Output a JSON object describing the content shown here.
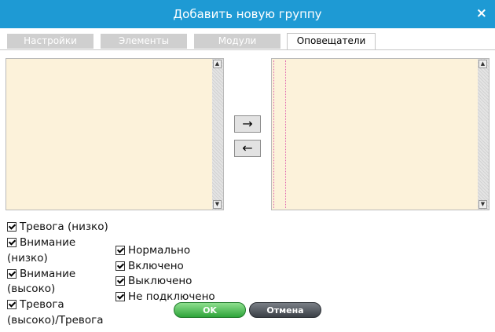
{
  "dialog": {
    "title": "Добавить новую группу",
    "close_glyph": "×"
  },
  "tabs": [
    {
      "label": "Настройки",
      "active": false
    },
    {
      "label": "Элементы",
      "active": false
    },
    {
      "label": "Модули",
      "active": false
    },
    {
      "label": "Оповещатели",
      "active": true
    }
  ],
  "transfer": {
    "add_glyph": "→",
    "remove_glyph": "←"
  },
  "scroll": {
    "up_glyph": "▲",
    "down_glyph": "▼"
  },
  "checkboxes_left": [
    {
      "label": "Тревога (низко)",
      "checked": true
    },
    {
      "label": "Внимание",
      "continuation": "(низко)",
      "checked": true
    },
    {
      "label": "Внимание",
      "continuation": "(высоко)",
      "checked": true
    },
    {
      "label": "Тревога",
      "continuation": "(высоко)/Тревога",
      "checked": true
    }
  ],
  "checkboxes_right": [
    {
      "label": "Нормально",
      "checked": true
    },
    {
      "label": "Включено",
      "checked": true
    },
    {
      "label": "Выключено",
      "checked": true
    },
    {
      "label": "Не подключено",
      "checked": true
    }
  ],
  "buttons": {
    "ok": "OK",
    "cancel": "Отмена"
  },
  "colors": {
    "titlebar": "#1e9ad4",
    "listbox": "#fcf2da",
    "ok_green": "#2ea43a",
    "cancel_dark": "#3b4047"
  },
  "icons": [
    "close-icon",
    "arrow-right-icon",
    "arrow-left-icon",
    "scroll-up-icon",
    "scroll-down-icon",
    "checkbox-icon"
  ]
}
